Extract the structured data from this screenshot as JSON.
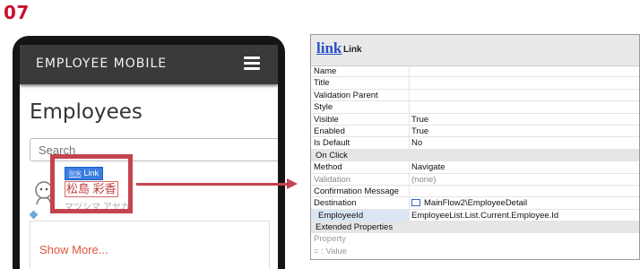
{
  "step_label": "07",
  "phone": {
    "app_title": "EMPLOYEE MOBILE",
    "heading": "Employees",
    "search_placeholder": "Search",
    "link_widget_icon_text": "link",
    "link_widget_label": "Link",
    "employee_name": "松島 彩香",
    "employee_kana": "マツシマ アヤカ",
    "show_more": "Show More..."
  },
  "panel": {
    "widget_icon_text": "link",
    "widget_name": "Link",
    "rows": [
      {
        "key": "Name",
        "value": ""
      },
      {
        "key": "Title",
        "value": ""
      },
      {
        "key": "Validation Parent",
        "value": ""
      },
      {
        "key": "Style",
        "value": ""
      },
      {
        "key": "Visible",
        "value": "True"
      },
      {
        "key": "Enabled",
        "value": "True"
      },
      {
        "key": "Is Default",
        "value": "No"
      }
    ],
    "section_onclick": "On Click",
    "onclick_rows": [
      {
        "key": "Method",
        "value": "Navigate"
      },
      {
        "key": "Validation",
        "value": "(none)"
      },
      {
        "key": "Confirmation Message",
        "value": ""
      },
      {
        "key": "Destination",
        "value": "MainFlow2\\EmployeeDetail"
      }
    ],
    "param": {
      "key": "EmployeeId",
      "value": "EmployeeList.List.Current.Employee.Id"
    },
    "section_extended": "Extended Properties",
    "extended_rows": [
      "Property",
      "= : Value"
    ]
  },
  "colors": {
    "accent_red": "#c5434f",
    "link_blue": "#2a4fc6",
    "show_more": "#e0533b"
  }
}
